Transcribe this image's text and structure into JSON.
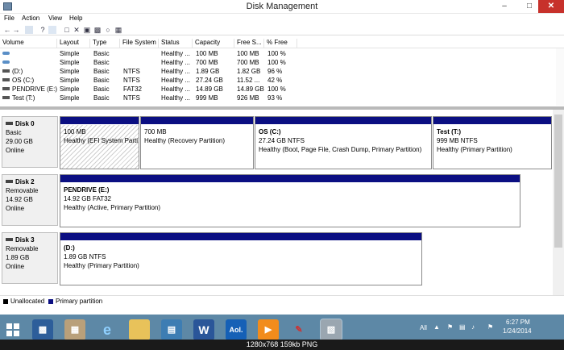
{
  "window": {
    "title": "Disk Management"
  },
  "menu": [
    "File",
    "Action",
    "View",
    "Help"
  ],
  "volume_table": {
    "columns": [
      "Volume",
      "Layout",
      "Type",
      "File System",
      "Status",
      "Capacity",
      "Free S...",
      "% Free"
    ],
    "rows": [
      [
        "",
        "Simple",
        "Basic",
        "",
        "Healthy ...",
        "100 MB",
        "100 MB",
        "100 %"
      ],
      [
        "",
        "Simple",
        "Basic",
        "",
        "Healthy ...",
        "700 MB",
        "700 MB",
        "100 %"
      ],
      [
        "(D:)",
        "Simple",
        "Basic",
        "NTFS",
        "Healthy ...",
        "1.89 GB",
        "1.82 GB",
        "96 %"
      ],
      [
        "OS (C:)",
        "Simple",
        "Basic",
        "NTFS",
        "Healthy ...",
        "27.24 GB",
        "11.52 ...",
        "42 %"
      ],
      [
        "PENDRIVE (E:)",
        "Simple",
        "Basic",
        "FAT32",
        "Healthy ...",
        "14.89 GB",
        "14.89 GB",
        "100 %"
      ],
      [
        "Test (T:)",
        "Simple",
        "Basic",
        "NTFS",
        "Healthy ...",
        "999 MB",
        "926 MB",
        "93 %"
      ]
    ]
  },
  "disks": [
    {
      "name": "Disk 0",
      "kind": "Basic",
      "size": "29.00 GB",
      "state": "Online",
      "partitions": [
        {
          "name": "",
          "size": "100 MB",
          "status": "Healthy (EFI System Parti"
        },
        {
          "name": "",
          "size": "700 MB",
          "status": "Healthy (Recovery Partition)"
        },
        {
          "name": "OS  (C:)",
          "size": "27.24 GB NTFS",
          "status": "Healthy (Boot, Page File, Crash Dump, Primary Partition)"
        },
        {
          "name": "Test  (T:)",
          "size": "999 MB NTFS",
          "status": "Healthy (Primary Partition)"
        }
      ]
    },
    {
      "name": "Disk 2",
      "kind": "Removable",
      "size": "14.92 GB",
      "state": "Online",
      "partitions": [
        {
          "name": "PENDRIVE  (E:)",
          "size": "14.92 GB FAT32",
          "status": "Healthy (Active, Primary Partition)"
        }
      ]
    },
    {
      "name": "Disk 3",
      "kind": "Removable",
      "size": "1.89 GB",
      "state": "Online",
      "partitions": [
        {
          "name": "(D:)",
          "size": "1.89 GB NTFS",
          "status": "Healthy (Primary Partition)"
        }
      ]
    }
  ],
  "legend": [
    {
      "label": "Unallocated",
      "color": "#000000"
    },
    {
      "label": "Primary partition",
      "color": "#0b0f82"
    }
  ],
  "taskbar": {
    "apps": [
      "Aol."
    ],
    "language": "All",
    "time": "6:27 PM",
    "date": "1/24/2014"
  },
  "caption": "1280x768  159kb  PNG",
  "colors": {
    "partition_bar": "#0b0f82",
    "taskbar": "#5d88a6",
    "close": "#c7312b"
  }
}
